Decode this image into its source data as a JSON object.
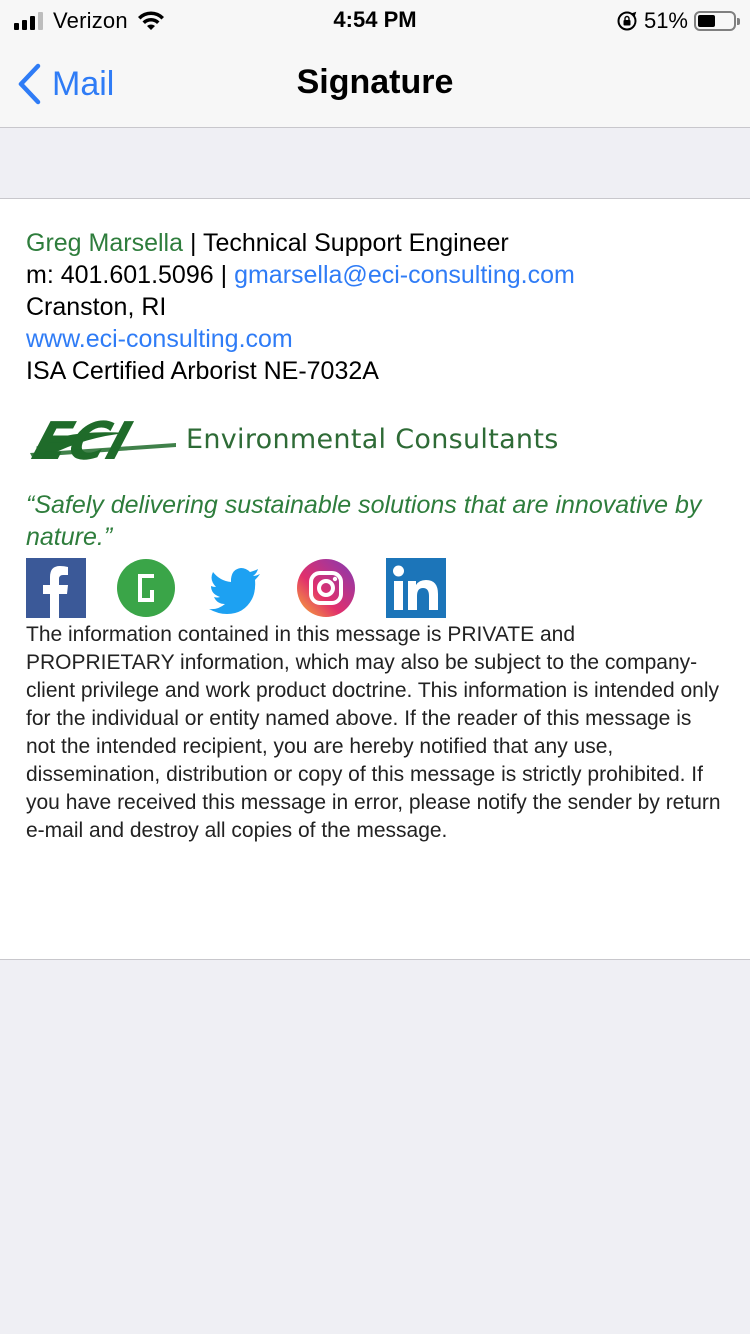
{
  "status_bar": {
    "carrier": "Verizon",
    "time": "4:54 PM",
    "battery_percent": "51%",
    "battery_level": 0.51,
    "signal_bars": 3
  },
  "nav": {
    "back_label": "Mail",
    "title": "Signature"
  },
  "signature": {
    "name": "Greg Marsella",
    "separator": "|",
    "job_title": "Technical Support Engineer",
    "mobile_prefix": "m: 401.601.5096",
    "email": "gmarsella@eci-consulting.com",
    "location": "Cranston, RI",
    "website": "www.eci-consulting.com",
    "certification": "ISA Certified Arborist NE-7032A",
    "logo_mark_text": "ECI",
    "logo_text": "Environmental Consultants",
    "tagline": "“Safely delivering sustainable solutions that are innovative by nature.”",
    "social_icons": [
      "facebook-icon",
      "glassdoor-icon",
      "twitter-icon",
      "instagram-icon",
      "linkedin-icon"
    ],
    "disclaimer": "The information contained in this message is PRIVATE and PROPRIETARY information, which may also be subject to the company-client privilege and work product doctrine. This information is intended only for the individual or entity named above. If the reader of this message is not the intended recipient, you are hereby notified that any use, dissemination, distribution or copy of this message is strictly prohibited. If you have received this message in error, please notify the sender by return e-mail and destroy all copies of the message."
  },
  "colors": {
    "ios_blue": "#2f7cf6",
    "eci_green": "#2e7d3c",
    "background": "#efeff4"
  }
}
